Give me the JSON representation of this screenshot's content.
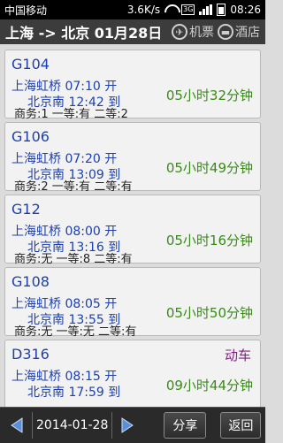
{
  "status_bar": {
    "carrier": "中国移动",
    "speed": "3.6K/s",
    "network": "3G",
    "time": "08:26"
  },
  "header": {
    "route": "上海 -> 北京 01月28日",
    "flights_label": "机票",
    "hotels_label": "酒店"
  },
  "trains": [
    {
      "code": "G104",
      "dep": "上海虹桥 07:10 开",
      "arr": "北京南 12:42 到",
      "duration": "05小时32分钟",
      "seats": "商务:1 一等:有 二等:2",
      "kind": ""
    },
    {
      "code": "G106",
      "dep": "上海虹桥 07:20 开",
      "arr": "北京南 13:09 到",
      "duration": "05小时49分钟",
      "seats": "商务:2 一等:有 二等:有",
      "kind": ""
    },
    {
      "code": "G12",
      "dep": "上海虹桥 08:00 开",
      "arr": "北京南 13:16 到",
      "duration": "05小时16分钟",
      "seats": "商务:无 一等:8 二等:有",
      "kind": ""
    },
    {
      "code": "G108",
      "dep": "上海虹桥 08:05 开",
      "arr": "北京南 13:55 到",
      "duration": "05小时50分钟",
      "seats": "商务:无 一等:无 二等:有",
      "kind": ""
    },
    {
      "code": "D316",
      "dep": "上海虹桥 08:15 开",
      "arr": "北京南 17:59 到",
      "duration": "09小时44分钟",
      "seats": "",
      "kind": "动车"
    }
  ],
  "bottom": {
    "date": "2014-01-28",
    "share_label": "分享",
    "back_label": "返回"
  },
  "colors": {
    "header_bg": "#3c3c3c",
    "code_blue": "#1d3fae",
    "duration_green": "#3a8a1a",
    "kind_purple": "#8a1a8a"
  }
}
